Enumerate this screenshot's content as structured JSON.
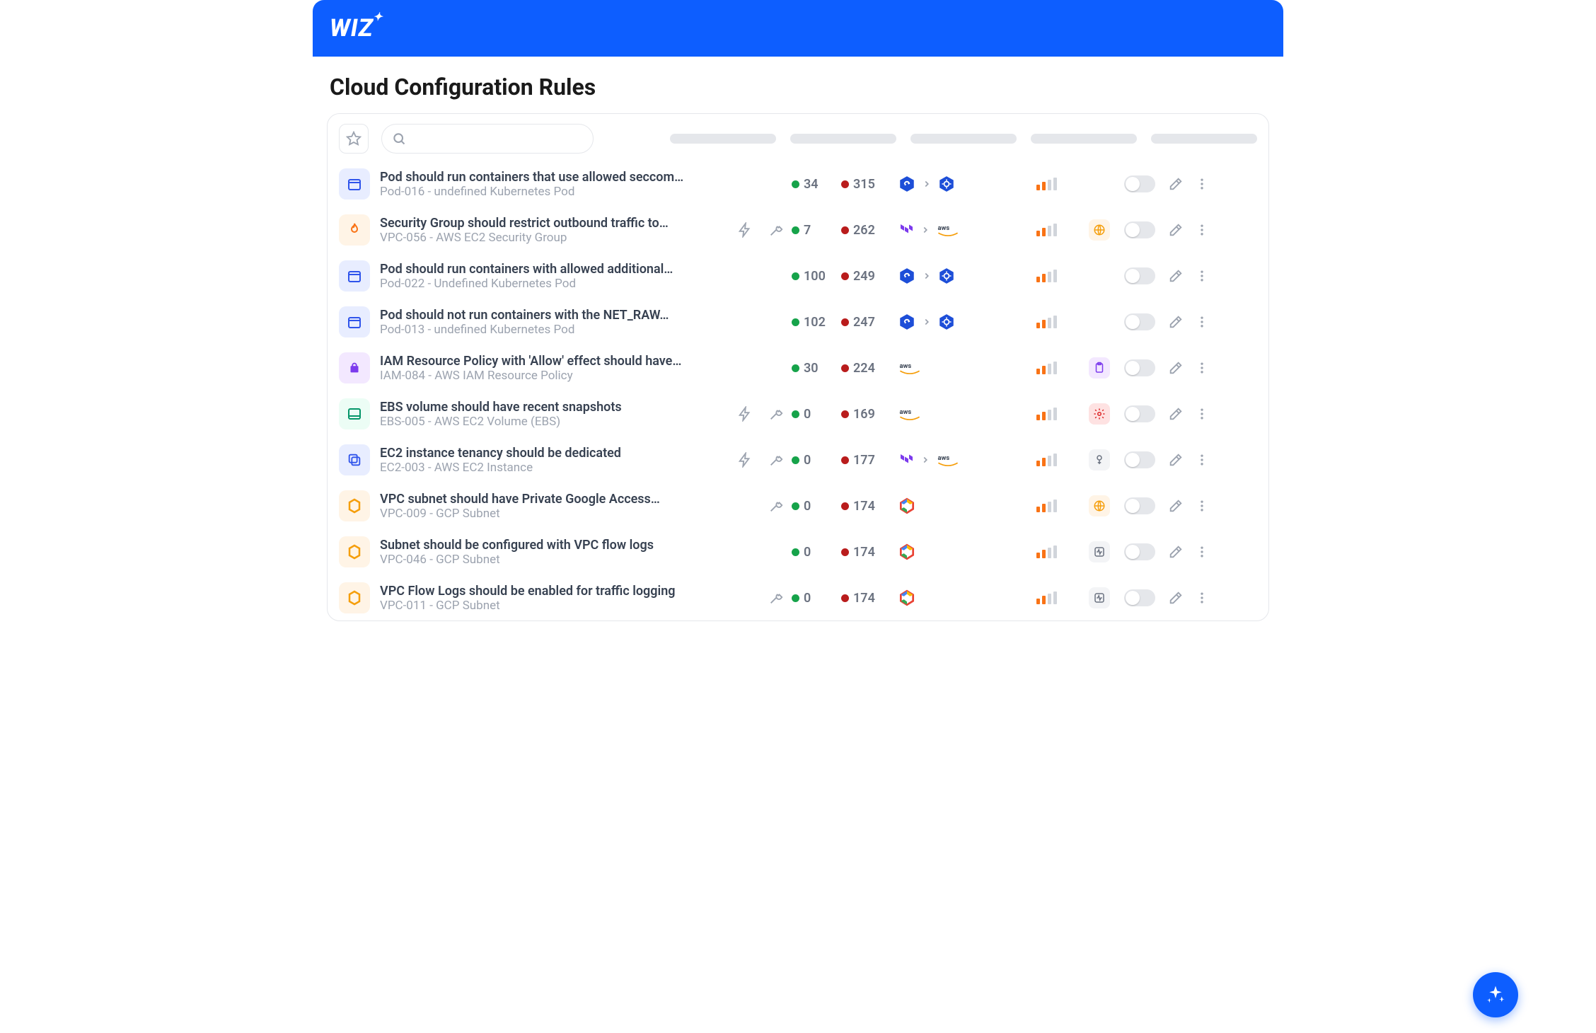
{
  "header": {
    "brand": "WIZ"
  },
  "page": {
    "title": "Cloud Configuration Rules"
  },
  "search": {
    "placeholder": ""
  },
  "rows": [
    {
      "icon": "box",
      "iconClass": "ic-blue-box",
      "title": "Pod should run containers that use allowed seccom…",
      "sub": "Pod-016 - undefined Kubernetes Pod",
      "bolt": false,
      "wrench": false,
      "green": "34",
      "red": "315",
      "platforms": [
        "k8s-refresh",
        "chev",
        "k8s"
      ],
      "badge": null
    },
    {
      "icon": "fire",
      "iconClass": "ic-orange-fire",
      "title": "Security Group should restrict outbound traffic to…",
      "sub": "VPC-056 - AWS EC2 Security Group",
      "bolt": true,
      "wrench": true,
      "green": "7",
      "red": "262",
      "platforms": [
        "terraform",
        "chev",
        "aws"
      ],
      "badge": "globe-orange"
    },
    {
      "icon": "box",
      "iconClass": "ic-blue-box",
      "title": "Pod should run containers with allowed additional…",
      "sub": "Pod-022 - Undefined Kubernetes Pod",
      "bolt": false,
      "wrench": false,
      "green": "100",
      "red": "249",
      "platforms": [
        "k8s-refresh",
        "chev",
        "k8s"
      ],
      "badge": null
    },
    {
      "icon": "box",
      "iconClass": "ic-blue-box",
      "title": "Pod should not run containers with the NET_RAW…",
      "sub": "Pod-013 - undefined Kubernetes Pod",
      "bolt": false,
      "wrench": false,
      "green": "102",
      "red": "247",
      "platforms": [
        "k8s-refresh",
        "chev",
        "k8s"
      ],
      "badge": null
    },
    {
      "icon": "iam",
      "iconClass": "ic-purple",
      "title": "IAM Resource Policy with 'Allow' effect should have…",
      "sub": "IAM-084 - AWS IAM Resource Policy",
      "bolt": false,
      "wrench": false,
      "green": "30",
      "red": "224",
      "platforms": [
        "aws"
      ],
      "badge": "clipboard-purple"
    },
    {
      "icon": "disk",
      "iconClass": "ic-green",
      "title": "EBS volume should have recent snapshots",
      "sub": "EBS-005 - AWS EC2 Volume (EBS)",
      "bolt": true,
      "wrench": true,
      "green": "0",
      "red": "169",
      "platforms": [
        "aws"
      ],
      "badge": "gear-red"
    },
    {
      "icon": "copy",
      "iconClass": "ic-blue-box",
      "title": "EC2 instance tenancy should be dedicated",
      "sub": "EC2-003 - AWS EC2 Instance",
      "bolt": true,
      "wrench": true,
      "green": "0",
      "red": "177",
      "platforms": [
        "terraform",
        "chev",
        "aws"
      ],
      "badge": "tool-gray"
    },
    {
      "icon": "ring",
      "iconClass": "ic-orange-ring",
      "title": "VPC subnet should have Private Google Access…",
      "sub": "VPC-009 - GCP Subnet",
      "bolt": false,
      "wrench": true,
      "green": "0",
      "red": "174",
      "platforms": [
        "gcp"
      ],
      "badge": "globe-orange"
    },
    {
      "icon": "ring",
      "iconClass": "ic-orange-ring",
      "title": "Subnet should be configured with VPC flow logs",
      "sub": "VPC-046 - GCP Subnet",
      "bolt": false,
      "wrench": false,
      "green": "0",
      "red": "174",
      "platforms": [
        "gcp"
      ],
      "badge": "pulse-gray"
    },
    {
      "icon": "ring",
      "iconClass": "ic-orange-ring",
      "title": "VPC Flow Logs should be enabled for traffic logging",
      "sub": "VPC-011 - GCP Subnet",
      "bolt": false,
      "wrench": true,
      "green": "0",
      "red": "174",
      "platforms": [
        "gcp"
      ],
      "badge": "pulse-gray"
    }
  ]
}
